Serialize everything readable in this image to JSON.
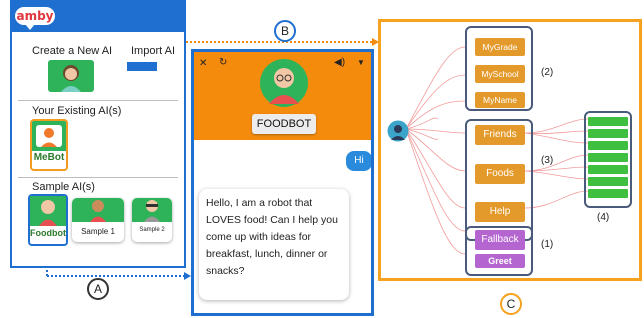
{
  "amby_panel": {
    "logo_text": "amby",
    "create_label": "Create a New AI",
    "import_label": "Import AI",
    "existing_label": "Your Existing AI(s)",
    "mebot_label": "MeBot",
    "sample_label": "Sample AI(s)",
    "samples": [
      {
        "label": "Foodbot"
      },
      {
        "label": "Sample 1"
      },
      {
        "label": "Sample 2"
      }
    ],
    "marker": "A"
  },
  "chat_panel": {
    "bot_name": "FOODBOT",
    "user_message": "Hi",
    "bot_message": "Hello, I am a robot that LOVES food! Can I help you come up with ideas for breakfast, lunch, dinner or snacks?",
    "marker": "B"
  },
  "graph_panel": {
    "marker": "C",
    "group2": {
      "label": "(2)",
      "items": [
        "MyGrade",
        "MySchool",
        "MyName"
      ]
    },
    "group3": {
      "label": "(3)",
      "items": [
        "Friends",
        "Foods",
        "Help"
      ]
    },
    "group1": {
      "label": "(1)",
      "items": [
        "Fallback",
        "Greet"
      ]
    },
    "group4": {
      "label": "(4)",
      "bar_count": 7
    }
  },
  "colors": {
    "primary_blue": "#1f6fd1",
    "accent_orange": "#f48b0d",
    "green": "#2fb35a",
    "purple": "#b465cf"
  }
}
